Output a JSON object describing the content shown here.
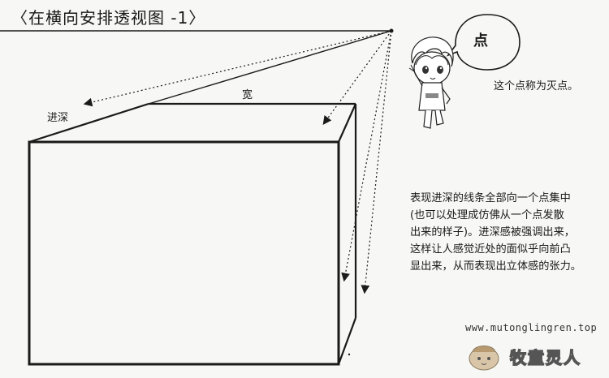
{
  "title": "〈在横向安排透视图 -1〉",
  "labels": {
    "depth": "进深",
    "width": "宽"
  },
  "bubble": {
    "text": "点"
  },
  "caption": "这个点称为灭点。",
  "description": [
    "表现进深的线条全部向一个点集中",
    "(也可以处理成仿佛从一个点发散",
    "出来的样子)。进深感被强调出来，",
    "这样让人感觉近处的面似乎向前凸",
    "显出来，从而表现出立体感的张力。"
  ],
  "watermark": {
    "url": "www.mutonglingren.top",
    "brand": "牧童灵人"
  },
  "colors": {
    "ink": "#1a1a1a",
    "paper": "#f7f7f5"
  }
}
